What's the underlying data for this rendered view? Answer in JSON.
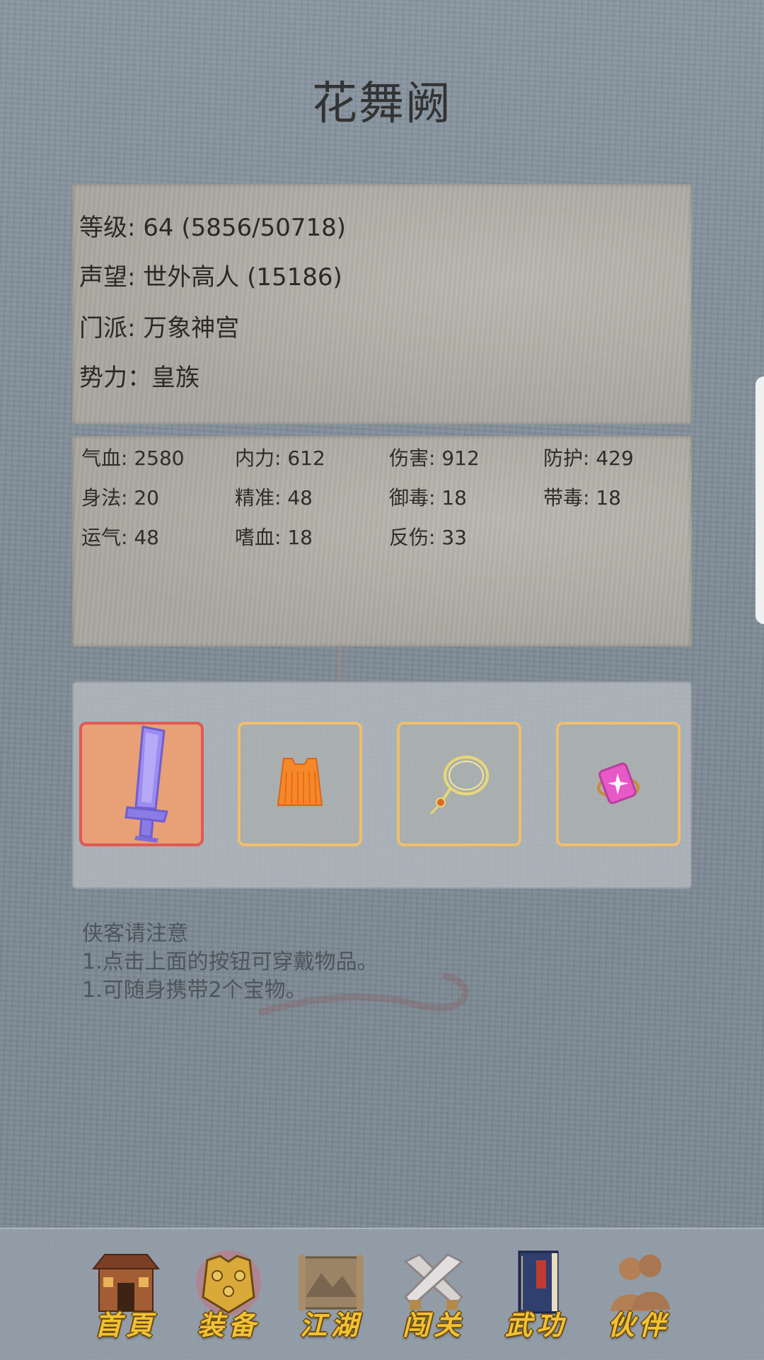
{
  "character": {
    "name": "花舞阙"
  },
  "info": {
    "level": "等级: 64 (5856/50718)",
    "reputation": "声望: 世外高人 (15186)",
    "sect": "门派: 万象神宫",
    "faction": "势力：皇族"
  },
  "stats": [
    "气血: 2580",
    "内力: 612",
    "伤害: 912",
    "防护: 429",
    "身法: 20",
    "精准: 48",
    "御毒: 18",
    "带毒: 18",
    "运气: 48",
    "嗜血: 18",
    "反伤: 33"
  ],
  "equipment": {
    "slots": [
      {
        "icon": "sword-icon",
        "color": "#9c8cf0"
      },
      {
        "icon": "armor-vest-icon",
        "color": "#f7882a"
      },
      {
        "icon": "necklace-icon",
        "color": "#e9d777"
      },
      {
        "icon": "ring-gem-icon",
        "color": "#e659c6"
      }
    ]
  },
  "notice": {
    "title": "侠客请注意",
    "line1": "1.点击上面的按钮可穿戴物品。",
    "line2": "1.可随身携带2个宝物。"
  },
  "nav": {
    "items": [
      {
        "label": "首頁",
        "icon": "house-icon"
      },
      {
        "label": "装备",
        "icon": "armor-icon"
      },
      {
        "label": "江湖",
        "icon": "scroll-map-icon"
      },
      {
        "label": "闯关",
        "icon": "crossed-swords-icon"
      },
      {
        "label": "武功",
        "icon": "book-icon"
      },
      {
        "label": "伙伴",
        "icon": "partners-icon"
      }
    ]
  },
  "colors": {
    "nav_label": "#f2c233",
    "active_slot_border": "#e05a55",
    "slot_border": "#f0be6b"
  }
}
